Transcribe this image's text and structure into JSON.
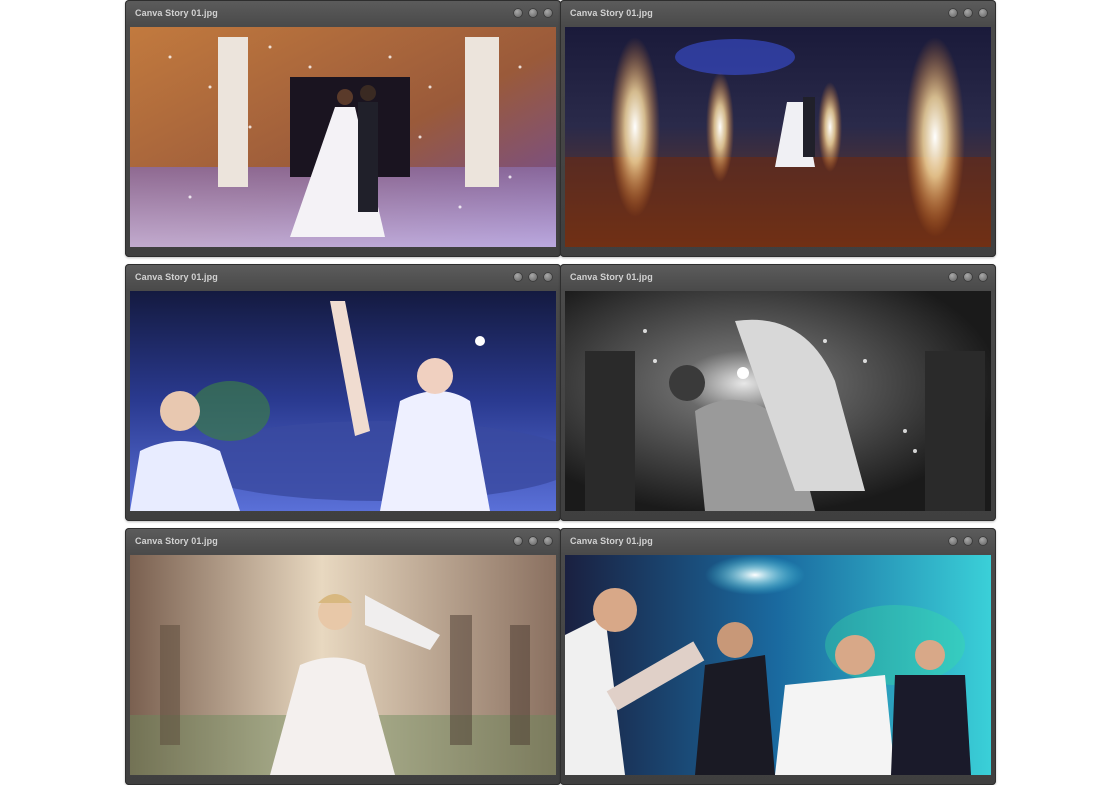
{
  "windows": [
    {
      "title": "Canva Story 01.jpg",
      "photo": "wedding-couple-confetti-photo",
      "accent": "#b06a3a"
    },
    {
      "title": "Canva Story 01.jpg",
      "photo": "first-dance-sparklers-photo",
      "accent": "#2a3f9a"
    },
    {
      "title": "Canva Story 01.jpg",
      "photo": "bride-dancing-with-guest-photo",
      "accent": "#3c58c8"
    },
    {
      "title": "Canva Story 01.jpg",
      "photo": "black-and-white-dance-dip-photo",
      "accent": "#7a7a7a"
    },
    {
      "title": "Canva Story 01.jpg",
      "photo": "bride-dancing-warm-blur-photo",
      "accent": "#c8a070"
    },
    {
      "title": "Canva Story 01.jpg",
      "photo": "groomsmen-party-blue-lights-photo",
      "accent": "#2fa8c8"
    }
  ]
}
